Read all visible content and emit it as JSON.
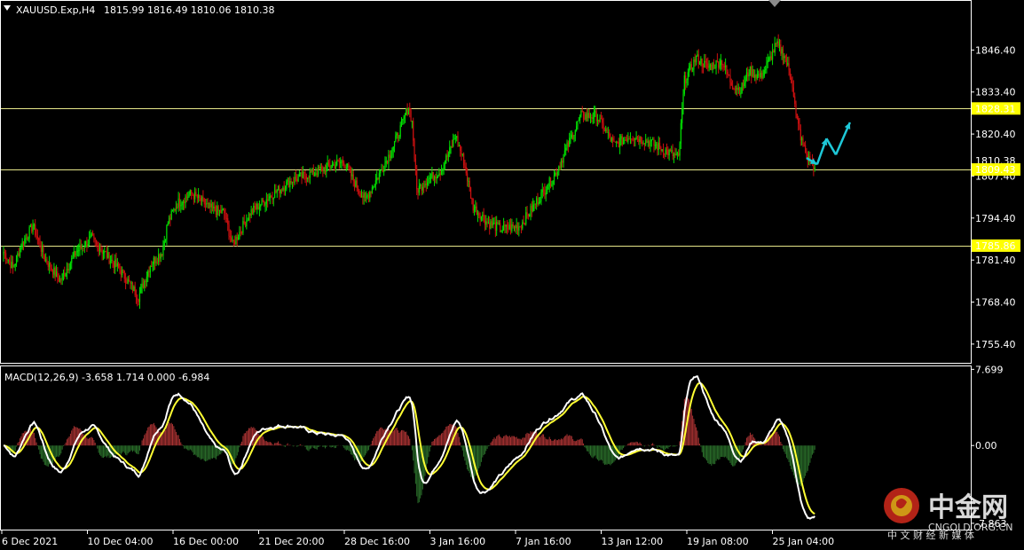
{
  "header": {
    "symbol_label": "XAUUSD.Exp,H4",
    "ohlc": "1815.99 1816.49 1810.06 1810.38",
    "menu_icon": "triangle-down-icon"
  },
  "colors": {
    "background": "#000000",
    "bull": "#00e000",
    "bear": "#cc1010",
    "level_line": "#e6e68a",
    "level_label_bg": "#ffff00",
    "arrow": "#1ec8d8",
    "macd_line": "#ffffff",
    "signal_line": "#ffff33",
    "hist_pos": "#a83232",
    "hist_neg": "#2a6e2a"
  },
  "chart_data": [
    {
      "type": "candlestick",
      "y_ticks": [
        1846.4,
        1833.4,
        1820.4,
        1807.4,
        1794.4,
        1781.4,
        1768.4,
        1755.4
      ],
      "ylim": [
        1749.6,
        1861.6
      ],
      "x_ticks": [
        "6 Dec 2021",
        "10 Dec 04:00",
        "16 Dec 00:00",
        "21 Dec 20:00",
        "28 Dec 16:00",
        "3 Jan 16:00",
        "7 Jan 16:00",
        "13 Jan 12:00",
        "19 Jan 08:00",
        "25 Jan 04:00"
      ],
      "levels": [
        {
          "value": 1828.31,
          "label": "1828.31"
        },
        {
          "value": 1809.43,
          "label": "1809.43"
        },
        {
          "value": 1785.86,
          "label": "1785.86"
        }
      ],
      "hidden_level_label": "1810.38",
      "close_anchors": [
        [
          0,
          1784
        ],
        [
          8,
          1779
        ],
        [
          15,
          1786
        ],
        [
          25,
          1792
        ],
        [
          35,
          1782
        ],
        [
          48,
          1775
        ],
        [
          62,
          1784
        ],
        [
          75,
          1788
        ],
        [
          85,
          1784
        ],
        [
          100,
          1778
        ],
        [
          115,
          1770
        ],
        [
          125,
          1780
        ],
        [
          135,
          1784
        ],
        [
          140,
          1793
        ],
        [
          148,
          1799
        ],
        [
          160,
          1802
        ],
        [
          178,
          1797
        ],
        [
          188,
          1796
        ],
        [
          195,
          1786
        ],
        [
          210,
          1796
        ],
        [
          230,
          1802
        ],
        [
          245,
          1806
        ],
        [
          260,
          1808
        ],
        [
          275,
          1810
        ],
        [
          290,
          1812
        ],
        [
          298,
          1806
        ],
        [
          308,
          1800
        ],
        [
          320,
          1808
        ],
        [
          330,
          1815
        ],
        [
          338,
          1822
        ],
        [
          345,
          1829
        ],
        [
          348,
          1824
        ],
        [
          352,
          1803
        ],
        [
          360,
          1806
        ],
        [
          372,
          1809
        ],
        [
          380,
          1815
        ],
        [
          385,
          1820
        ],
        [
          392,
          1812
        ],
        [
          400,
          1798
        ],
        [
          412,
          1793
        ],
        [
          425,
          1791
        ],
        [
          440,
          1792
        ],
        [
          455,
          1800
        ],
        [
          470,
          1808
        ],
        [
          482,
          1818
        ],
        [
          492,
          1826
        ],
        [
          505,
          1826
        ],
        [
          520,
          1817
        ],
        [
          535,
          1820
        ],
        [
          550,
          1818
        ],
        [
          565,
          1815
        ],
        [
          575,
          1813
        ],
        [
          580,
          1837
        ],
        [
          590,
          1844
        ],
        [
          600,
          1841
        ],
        [
          612,
          1843
        ],
        [
          620,
          1836
        ],
        [
          628,
          1834
        ],
        [
          635,
          1840
        ],
        [
          645,
          1838
        ],
        [
          652,
          1843
        ],
        [
          658,
          1848
        ],
        [
          665,
          1845
        ],
        [
          672,
          1836
        ],
        [
          675,
          1826
        ],
        [
          680,
          1818
        ],
        [
          685,
          1813
        ],
        [
          691,
          1810
        ]
      ],
      "arrows": [
        {
          "from": [
            684,
            1813
          ],
          "to": [
            693,
            1811
          ]
        },
        {
          "from": [
            693,
            1811
          ],
          "to": [
            701,
            1819
          ]
        },
        {
          "from": [
            701,
            1819
          ],
          "to": [
            709,
            1814
          ]
        },
        {
          "from": [
            709,
            1814
          ],
          "to": [
            721,
            1824
          ]
        }
      ]
    },
    {
      "type": "macd",
      "label": "MACD(12,26,9) -3.658 1.714 0.000 -6.984",
      "y_ticks": [
        {
          "value": 7.699,
          "label": "7.699"
        },
        {
          "value": 0.0,
          "label": "0.00"
        },
        {
          "value": -7.863,
          "label": "-7.863"
        }
      ],
      "ylim": [
        -8.5,
        8.0
      ]
    }
  ],
  "watermark": {
    "brand_cn": "中金网",
    "brand_en": "CNGOLD.ORG.CN",
    "tagline_cn": "中 文 财 经 新 媒 体"
  }
}
